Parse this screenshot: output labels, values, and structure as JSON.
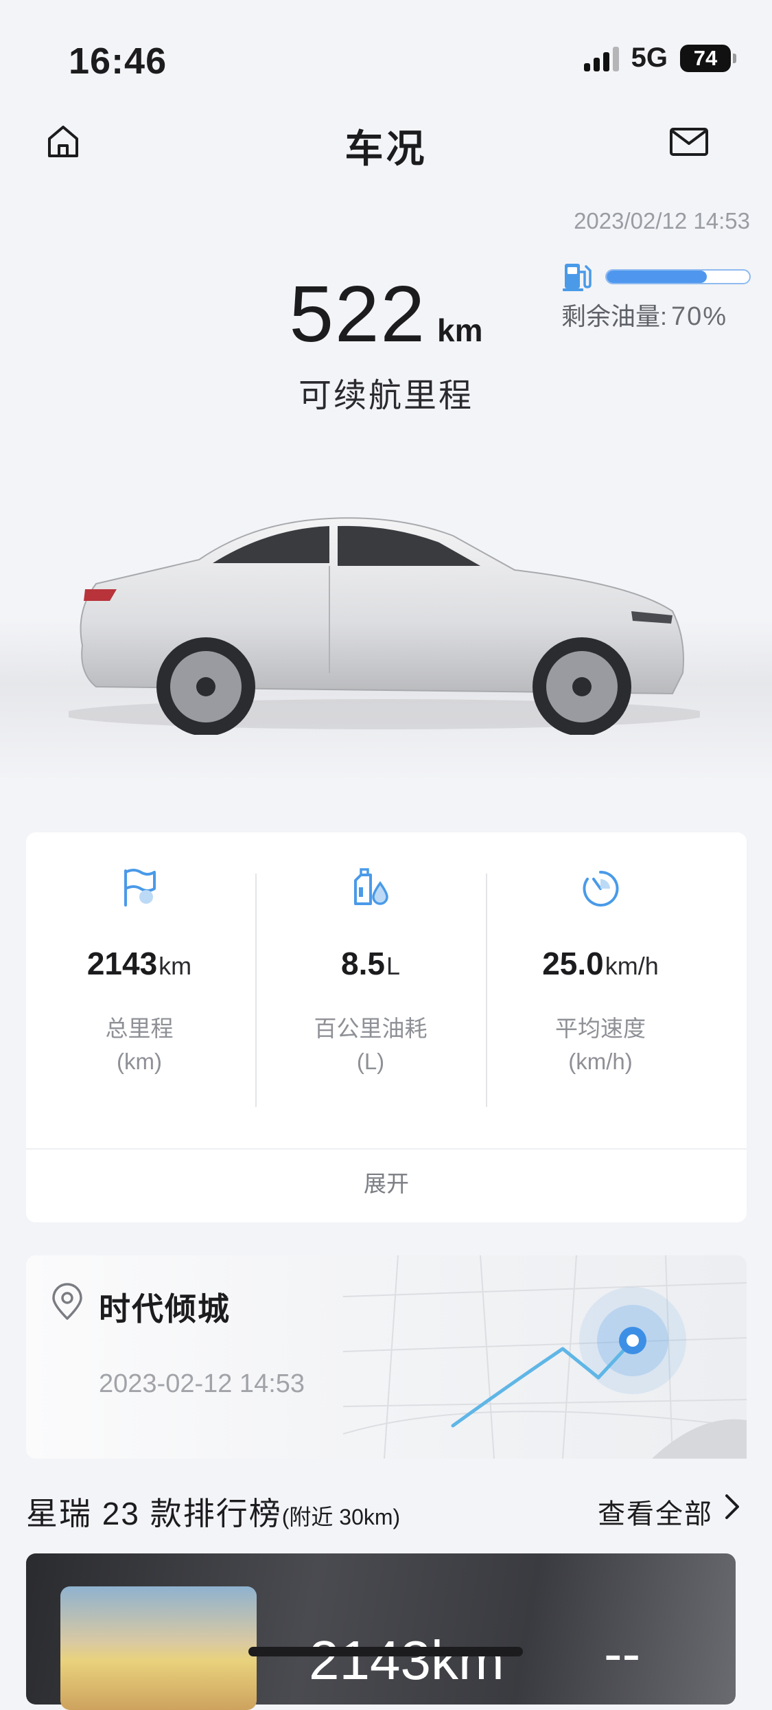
{
  "status_bar": {
    "time": "16:46",
    "network": "5G",
    "battery": "74"
  },
  "header": {
    "title": "车况"
  },
  "range": {
    "update_time": "2023/02/12 14:53",
    "value": "522",
    "unit": "km",
    "label": "可续航里程",
    "fuel_label": "剩余油量:",
    "fuel_percent_text": "70%",
    "fuel_level": 0.7
  },
  "stats": [
    {
      "icon": "flag-icon",
      "value": "2143",
      "unit": "km",
      "label": "总里程",
      "unit_label": "(km)"
    },
    {
      "icon": "fuel-can-icon",
      "value": "8.5",
      "unit": "L",
      "label": "百公里油耗",
      "unit_label": "(L)"
    },
    {
      "icon": "speedometer-icon",
      "value": "25.0",
      "unit": "km/h",
      "label": "平均速度",
      "unit_label": "(km/h)"
    }
  ],
  "stats_expand": "展开",
  "location": {
    "name": "时代倾城",
    "time": "2023-02-12 14:53"
  },
  "ranking": {
    "title": "星瑞 23 款排行榜",
    "subtitle": "(附近 30km)",
    "more": "查看全部",
    "value": "2143km",
    "dash": "--"
  },
  "colors": {
    "accent": "#4f97ee",
    "background": "#f3f4f7",
    "icon_blue": "#4a9ae8"
  }
}
